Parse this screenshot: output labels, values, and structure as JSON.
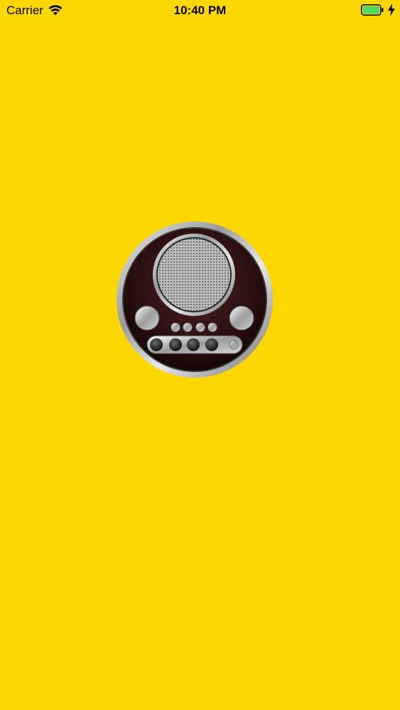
{
  "status_bar": {
    "carrier": "Carrier",
    "time": "10:40 PM",
    "wifi_icon": "wifi-icon",
    "battery_icon": "battery-icon",
    "charging_icon": "bolt-icon",
    "battery_color": "#4CD964"
  },
  "splash": {
    "background_color": "#FFD700",
    "logo_icon": "radio-logo-icon"
  }
}
